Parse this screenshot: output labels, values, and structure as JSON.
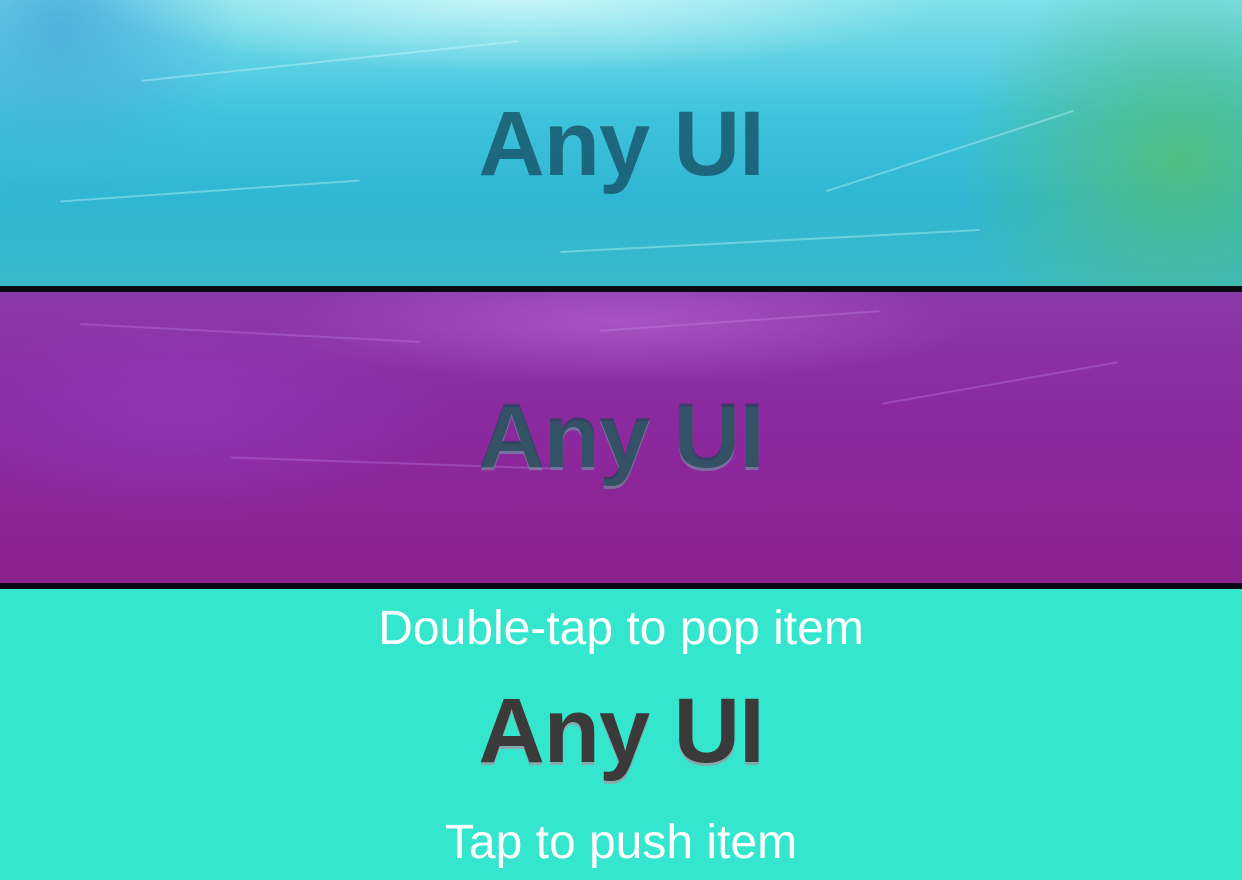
{
  "stack": {
    "items": [
      {
        "label": "Any UI"
      },
      {
        "label": "Any UI"
      },
      {
        "label": "Any UI"
      }
    ]
  },
  "hints": {
    "pop": "Double-tap to pop item",
    "push": "Tap to push item"
  },
  "colors": {
    "panel_1_tint": "#3fc3dd",
    "panel_2_tint": "#8b2aa0",
    "panel_3_background": "#33e6cd",
    "hint_text": "#ffffff",
    "title_text": "#3a3a3a"
  }
}
